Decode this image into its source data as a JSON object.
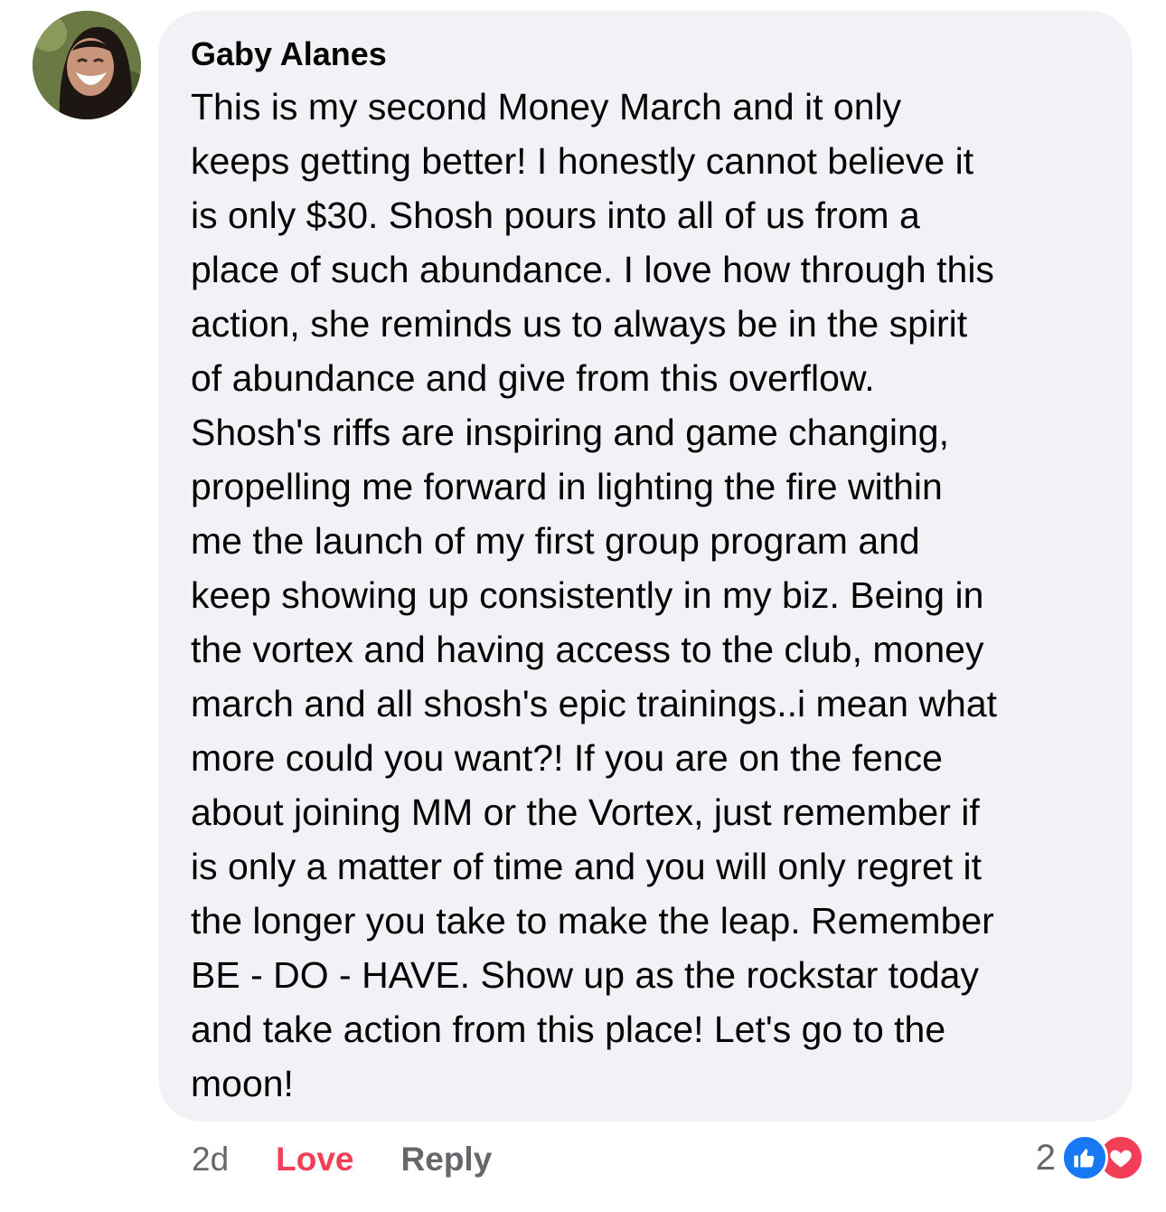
{
  "comment": {
    "author": "Gaby Alanes",
    "lines": [
      "This is my second Money March and it only",
      "keeps getting better! I honestly cannot believe it",
      "is only $30. Shosh pours into all of us from a",
      "place of such abundance. I love how through this",
      "action, she reminds us to always be in the spirit",
      "of abundance and give from this overflow.",
      "Shosh's riffs are inspiring and game changing,",
      "propelling me forward in lighting the fire within",
      "me the launch of my first group program and",
      "keep showing up consistently in my biz. Being in",
      "the vortex and having access to the club, money",
      "march and all shosh's epic trainings..i mean what",
      "more could you want?! If you are on the fence",
      "about joining MM or the Vortex, just remember if",
      "is only a matter of time and you will only regret it",
      "the longer you take to make the leap. Remember",
      "BE - DO - HAVE. Show up as the rockstar today",
      "and take action from this place! Let's go to the",
      "moon!"
    ]
  },
  "actions": {
    "time": "2d",
    "love_label": "Love",
    "reply_label": "Reply"
  },
  "reactions": {
    "count": "2",
    "icons": [
      "like-icon",
      "heart-icon"
    ]
  },
  "colors": {
    "bubble": "#f0f2f5",
    "love": "#f33e58",
    "like": "#1877f2",
    "muted": "#65676b"
  }
}
